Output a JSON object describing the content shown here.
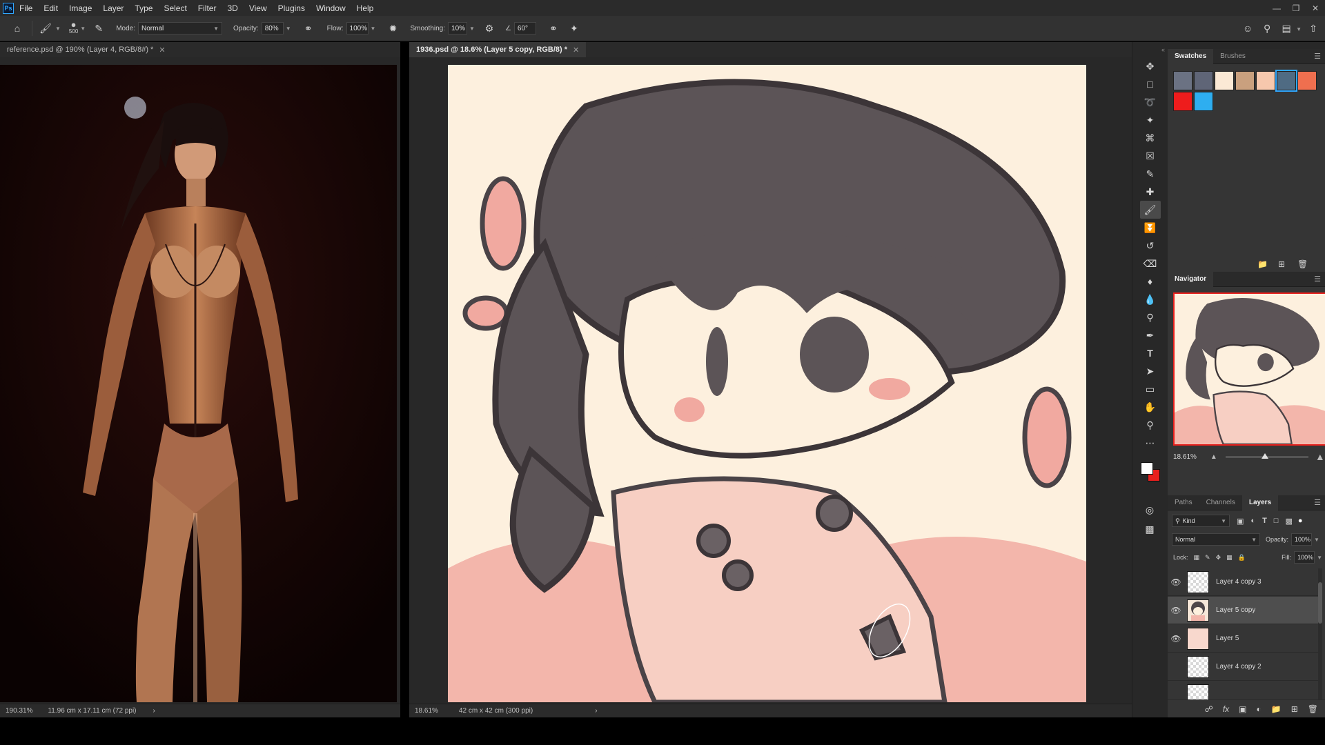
{
  "menubar": {
    "logo": "Ps",
    "items": [
      "File",
      "Edit",
      "Image",
      "Layer",
      "Type",
      "Select",
      "Filter",
      "3D",
      "View",
      "Plugins",
      "Window",
      "Help"
    ],
    "window_controls": [
      "minimize",
      "restore",
      "close"
    ]
  },
  "options": {
    "brush_size": "500",
    "mode_label": "Mode:",
    "mode_value": "Normal",
    "opacity_label": "Opacity:",
    "opacity_value": "80%",
    "flow_label": "Flow:",
    "flow_value": "100%",
    "smoothing_label": "Smoothing:",
    "smoothing_value": "10%",
    "angle_value": "60°"
  },
  "documents": {
    "left": {
      "tab_title": "reference.psd @ 190% (Layer 4, RGB/8#) *",
      "zoom": "190.31%",
      "doc_size": "11.96 cm x 17.11 cm (72 ppi)"
    },
    "right": {
      "tab_title": "1936.psd @ 18.6% (Layer 5 copy, RGB/8) *",
      "zoom": "18.61%",
      "doc_size": "42 cm x 42 cm (300 ppi)"
    }
  },
  "panels": {
    "swatches_tab": "Swatches",
    "brushes_tab": "Brushes",
    "swatch_colors": [
      "#6b7283",
      "#5f6577",
      "#fbe9d5",
      "#c9a07e",
      "#f7c8ad",
      "#4f6b83",
      "#ef6f4f",
      "#ee1c1c",
      "#2eaef0"
    ],
    "selected_swatch_index": 5,
    "navigator_title": "Navigator",
    "navigator_zoom": "18.61%",
    "paths_tab": "Paths",
    "channels_tab": "Channels",
    "layers_tab": "Layers",
    "filter_kind": "Kind",
    "blend_mode": "Normal",
    "opacity_label": "Opacity:",
    "opacity_value": "100%",
    "lock_label": "Lock:",
    "fill_label": "Fill:",
    "fill_value": "100%",
    "layers": [
      {
        "name": "Layer 4 copy 3",
        "visible": true,
        "selected": false
      },
      {
        "name": "Layer 5 copy",
        "visible": true,
        "selected": true
      },
      {
        "name": "Layer 5",
        "visible": true,
        "selected": false
      },
      {
        "name": "Layer 4 copy 2",
        "visible": false,
        "selected": false
      }
    ]
  },
  "colors": {
    "foreground": "#ffffff",
    "background": "#e8201d",
    "canvas_bg": "#fdf0de",
    "accent": "#31a8ff"
  },
  "tools": [
    "move-icon",
    "marquee-icon",
    "lasso-icon",
    "magic-wand-icon",
    "crop-icon",
    "frame-icon",
    "eyedropper-icon",
    "healing-icon",
    "brush-icon",
    "stamp-icon",
    "history-brush-icon",
    "eraser-icon",
    "bucket-icon",
    "blur-icon",
    "dodge-icon",
    "pen-icon",
    "type-icon",
    "path-select-icon",
    "rectangle-icon",
    "hand-icon",
    "zoom-icon",
    "more-icon"
  ]
}
